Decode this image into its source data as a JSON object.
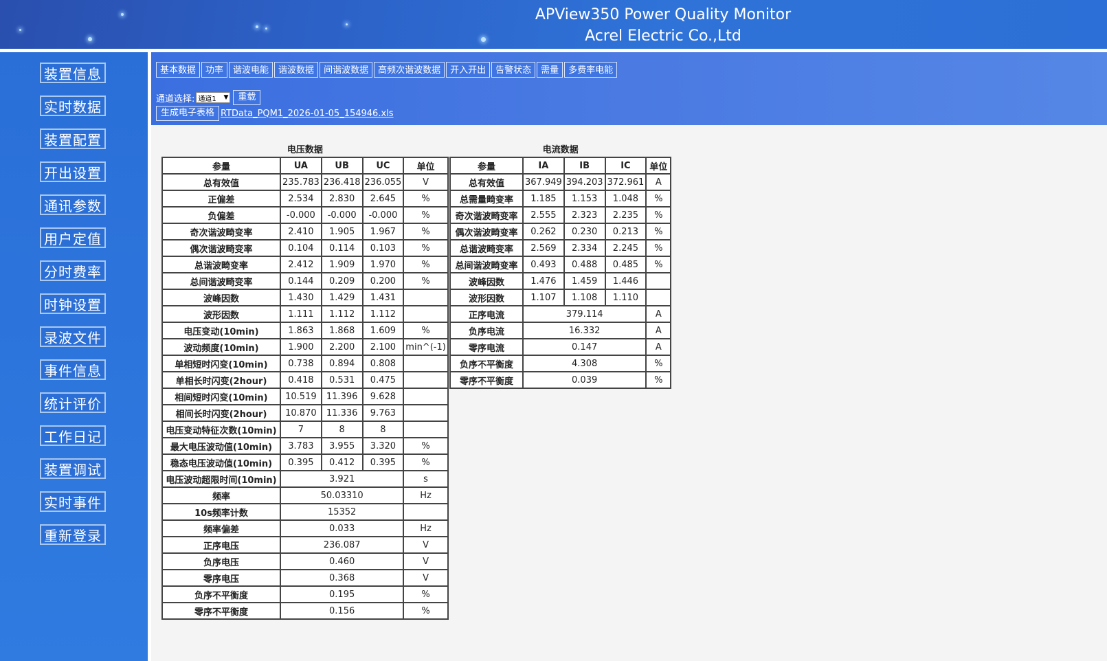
{
  "header": {
    "title_line1": "APView350 Power Quality Monitor",
    "title_line2": "Acrel Electric Co.,Ltd"
  },
  "sidebar": {
    "items": [
      {
        "label": "装置信息"
      },
      {
        "label": "实时数据"
      },
      {
        "label": "装置配置"
      },
      {
        "label": "开出设置"
      },
      {
        "label": "通讯参数"
      },
      {
        "label": "用户定值"
      },
      {
        "label": "分时费率"
      },
      {
        "label": "时钟设置"
      },
      {
        "label": "录波文件"
      },
      {
        "label": "事件信息"
      },
      {
        "label": "统计评价"
      },
      {
        "label": "工作日记"
      },
      {
        "label": "装置调试"
      },
      {
        "label": "实时事件"
      },
      {
        "label": "重新登录"
      }
    ]
  },
  "tabs": [
    "基本数据",
    "功率",
    "谐波电能",
    "谐波数据",
    "间谐波数据",
    "高频次谐波数据",
    "开入开出",
    "告警状态",
    "需量",
    "多费率电能"
  ],
  "channel": {
    "label": "通道选择:",
    "selected": "通道1",
    "reload_label": "重载"
  },
  "export": {
    "button_label": "生成电子表格",
    "file_name": "RTData_PQM1_2026-01-05_154946.xls"
  },
  "voltage": {
    "title": "电压数据",
    "headers": [
      "参量",
      "UA",
      "UB",
      "UC",
      "单位"
    ],
    "rows3": [
      [
        "总有效值",
        "235.783",
        "236.418",
        "236.055",
        "V"
      ],
      [
        "正偏差",
        "2.534",
        "2.830",
        "2.645",
        "%"
      ],
      [
        "负偏差",
        "-0.000",
        "-0.000",
        "-0.000",
        "%"
      ],
      [
        "奇次谐波畸变率",
        "2.410",
        "1.905",
        "1.967",
        "%"
      ],
      [
        "偶次谐波畸变率",
        "0.104",
        "0.114",
        "0.103",
        "%"
      ],
      [
        "总谐波畸变率",
        "2.412",
        "1.909",
        "1.970",
        "%"
      ],
      [
        "总间谐波畸变率",
        "0.144",
        "0.209",
        "0.200",
        "%"
      ],
      [
        "波峰因数",
        "1.430",
        "1.429",
        "1.431",
        ""
      ],
      [
        "波形因数",
        "1.111",
        "1.112",
        "1.112",
        ""
      ],
      [
        "电压变动(10min)",
        "1.863",
        "1.868",
        "1.609",
        "%"
      ],
      [
        "波动频度(10min)",
        "1.900",
        "2.200",
        "2.100",
        "min^(-1)"
      ],
      [
        "单相短时闪变(10min)",
        "0.738",
        "0.894",
        "0.808",
        ""
      ],
      [
        "单相长时闪变(2hour)",
        "0.418",
        "0.531",
        "0.475",
        ""
      ],
      [
        "相间短时闪变(10min)",
        "10.519",
        "11.396",
        "9.628",
        ""
      ],
      [
        "相间长时闪变(2hour)",
        "10.870",
        "11.336",
        "9.763",
        ""
      ],
      [
        "电压变动特征次数(10min)",
        "7",
        "8",
        "8",
        ""
      ],
      [
        "最大电压波动值(10min)",
        "3.783",
        "3.955",
        "3.320",
        "%"
      ],
      [
        "稳态电压波动值(10min)",
        "0.395",
        "0.412",
        "0.395",
        "%"
      ]
    ],
    "rows1": [
      [
        "电压波动超限时间(10min)",
        "3.921",
        "s"
      ],
      [
        "频率",
        "50.03310",
        "Hz"
      ],
      [
        "10s频率计数",
        "15352",
        ""
      ],
      [
        "频率偏差",
        "0.033",
        "Hz"
      ],
      [
        "正序电压",
        "236.087",
        "V"
      ],
      [
        "负序电压",
        "0.460",
        "V"
      ],
      [
        "零序电压",
        "0.368",
        "V"
      ],
      [
        "负序不平衡度",
        "0.195",
        "%"
      ],
      [
        "零序不平衡度",
        "0.156",
        "%"
      ]
    ]
  },
  "current": {
    "title": "电流数据",
    "headers": [
      "参量",
      "IA",
      "IB",
      "IC",
      "单位"
    ],
    "rows3": [
      [
        "总有效值",
        "367.949",
        "394.203",
        "372.961",
        "A"
      ],
      [
        "总需量畸变率",
        "1.185",
        "1.153",
        "1.048",
        "%"
      ],
      [
        "奇次谐波畸变率",
        "2.555",
        "2.323",
        "2.235",
        "%"
      ],
      [
        "偶次谐波畸变率",
        "0.262",
        "0.230",
        "0.213",
        "%"
      ],
      [
        "总谐波畸变率",
        "2.569",
        "2.334",
        "2.245",
        "%"
      ],
      [
        "总间谐波畸变率",
        "0.493",
        "0.488",
        "0.485",
        "%"
      ],
      [
        "波峰因数",
        "1.476",
        "1.459",
        "1.446",
        ""
      ],
      [
        "波形因数",
        "1.107",
        "1.108",
        "1.110",
        ""
      ]
    ],
    "rows1": [
      [
        "正序电流",
        "379.114",
        "A"
      ],
      [
        "负序电流",
        "16.332",
        "A"
      ],
      [
        "零序电流",
        "0.147",
        "A"
      ],
      [
        "负序不平衡度",
        "4.308",
        "%"
      ],
      [
        "零序不平衡度",
        "0.039",
        "%"
      ]
    ]
  },
  "colors": {
    "header_bg": "#2c62c8",
    "sidebar_bg": "#2f7be0",
    "band_bg": "#4a7ae2",
    "content_bg": "#f4f4f4"
  }
}
